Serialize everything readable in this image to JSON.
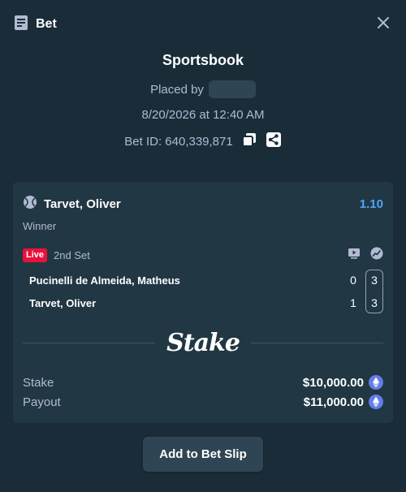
{
  "header": {
    "title": "Bet"
  },
  "summary": {
    "sportsbook": "Sportsbook",
    "placed_by_label": "Placed by",
    "datetime": "8/20/2026 at 12:40 AM",
    "bet_id_label": "Bet ID: 640,339,871"
  },
  "selection": {
    "outcome": "Tarvet, Oliver",
    "odds": "1.10",
    "market": "Winner",
    "live_badge": "Live",
    "period": "2nd Set",
    "players": [
      {
        "name": "Pucinelli de Almeida, Matheus",
        "sets": "0",
        "games": "3"
      },
      {
        "name": "Tarvet, Oliver",
        "sets": "1",
        "games": "3"
      }
    ]
  },
  "brand": "Stake",
  "totals": {
    "stake_label": "Stake",
    "stake_value": "$10,000.00",
    "payout_label": "Payout",
    "payout_value": "$11,000.00"
  },
  "cta": {
    "label": "Add to Bet Slip"
  },
  "colors": {
    "background": "#1a2c38",
    "card": "#213743",
    "odds": "#4ea5f5",
    "live": "#e9113c",
    "eth": "#627eea"
  },
  "icons": [
    "receipt-icon",
    "close-icon",
    "copy-icon",
    "share-icon",
    "tennis-ball-icon",
    "live-stream-icon",
    "stats-icon",
    "eth-icon"
  ]
}
